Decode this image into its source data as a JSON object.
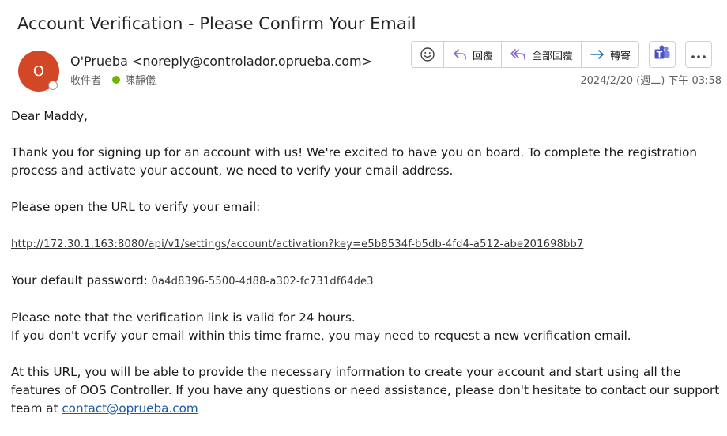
{
  "subject": "Account Verification - Please Confirm Your Email",
  "sender": {
    "initial": "O",
    "display": "O'Prueba <noreply@controlador.oprueba.com>",
    "avatar_color": "#d24726"
  },
  "recipient": {
    "label": "收件者",
    "name": "陳靜儀"
  },
  "toolbar": {
    "reply_label": "回覆",
    "reply_all_label": "全部回覆",
    "forward_label": "轉寄",
    "accent": "#8a67c7"
  },
  "datetime": "2024/2/20 (週二) 下午 03:58",
  "body": {
    "greeting": "Dear Maddy,",
    "para1": "Thank you for signing up for an account with us! We're excited to have you on board. To complete the registration process and activate your account, we need to verify your email address.",
    "para2": "Please open the URL to verify your email:",
    "url": "http://172.30.1.163:8080/api/v1/settings/account/activation?key=e5b8534f-b5db-4fd4-a512-abe201698bb7",
    "password_label": "Your default password:",
    "password_value": "0a4d8396-5500-4d88-a302-fc731df64de3",
    "note_line1": "Please note that the verification link is valid for 24 hours.",
    "note_line2": "If you don't verify your email within this time frame, you may need to request a new verification email.",
    "para4": "At this URL, you will be able to provide the necessary information to create your account and start using all the features of OOS Controller. If you have any questions or need assistance, please don't hesitate to contact our support team at",
    "contact_email": "contact@oprueba.com"
  }
}
